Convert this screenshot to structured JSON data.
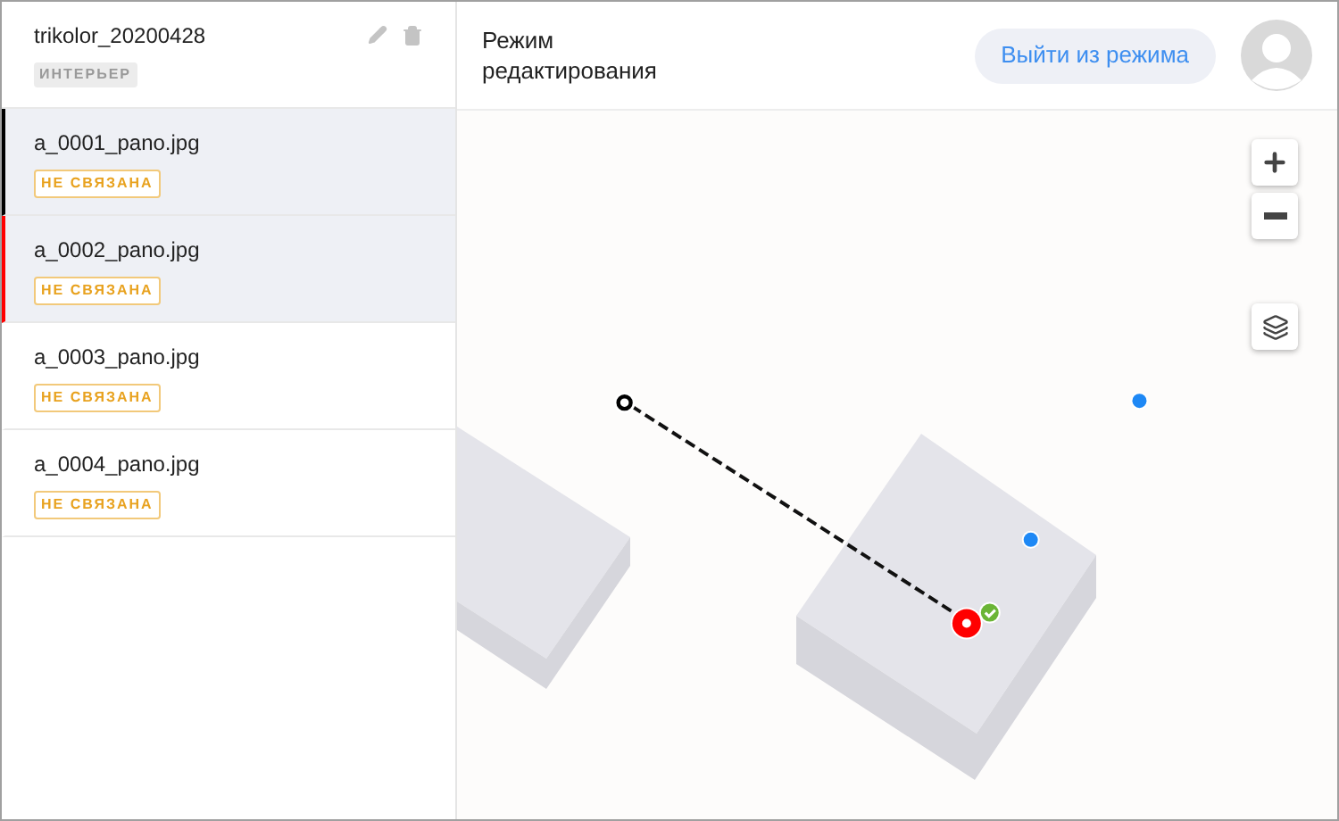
{
  "project": {
    "title": "trikolor_20200428",
    "tag": "ИНТЕРЬЕР"
  },
  "panoramas": [
    {
      "name": "a_0001_pano.jpg",
      "status": "НЕ СВЯЗАНА",
      "selected": true,
      "color": "#000000"
    },
    {
      "name": "a_0002_pano.jpg",
      "status": "НЕ СВЯЗАНА",
      "selected": true,
      "color": "#ff0000"
    },
    {
      "name": "a_0003_pano.jpg",
      "status": "НЕ СВЯЗАНА",
      "selected": false
    },
    {
      "name": "a_0004_pano.jpg",
      "status": "НЕ СВЯЗАНА",
      "selected": false
    }
  ],
  "header": {
    "title": "Режим редактирования",
    "exit_button": "Выйти из режима"
  }
}
